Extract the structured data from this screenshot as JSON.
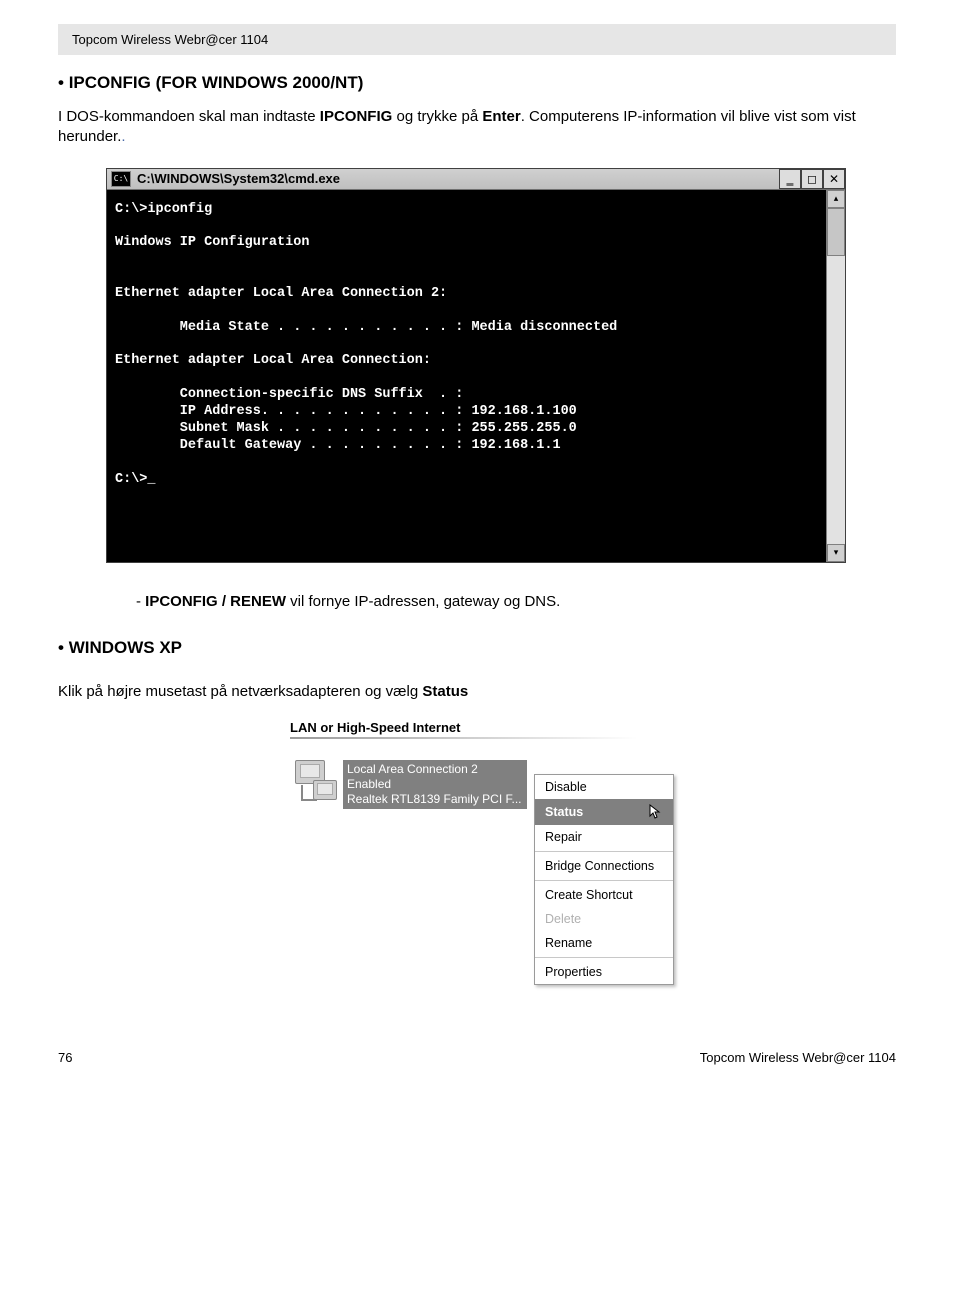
{
  "header_bar": "Topcom Wireless Webr@cer 1104",
  "section1": {
    "bullet": "•",
    "title": "IPCONFIG (FOR WINDOWS 2000/NT)",
    "para_prefix": "I DOS-kommandoen skal man indtaste ",
    "para_cmd": "IPCONFIG",
    "para_mid": " og trykke på ",
    "para_enter": "Enter",
    "para_suffix": ". Computerens IP-information vil blive vist som vist herunder.",
    "trailing_dot": "."
  },
  "cmd": {
    "title": "C:\\WINDOWS\\System32\\cmd.exe",
    "icon_text": "C:\\",
    "lines": [
      "C:\\>ipconfig",
      "",
      "Windows IP Configuration",
      "",
      "",
      "Ethernet adapter Local Area Connection 2:",
      "",
      "        Media State . . . . . . . . . . . : Media disconnected",
      "",
      "Ethernet adapter Local Area Connection:",
      "",
      "        Connection-specific DNS Suffix  . :",
      "        IP Address. . . . . . . . . . . . : 192.168.1.100",
      "        Subnet Mask . . . . . . . . . . . : 255.255.255.0",
      "        Default Gateway . . . . . . . . . : 192.168.1.1",
      "",
      "C:\\>_"
    ]
  },
  "renew": {
    "dash": "- ",
    "cmd": "IPCONFIG / RENEW",
    "text": " vil fornye IP-adressen, gateway og DNS."
  },
  "section2": {
    "bullet": "•",
    "title": "WINDOWS XP",
    "para_prefix": "Klik på højre musetast på netværksadapteren og vælg ",
    "status": "Status"
  },
  "lan": {
    "header": "LAN or High-Speed Internet",
    "line1": "Local Area Connection 2",
    "line2": "Enabled",
    "line3": "Realtek RTL8139 Family PCI F..."
  },
  "ctx": {
    "disable": "Disable",
    "status": "Status",
    "repair": "Repair",
    "bridge": "Bridge Connections",
    "shortcut": "Create Shortcut",
    "delete": "Delete",
    "rename": "Rename",
    "properties": "Properties"
  },
  "footer": {
    "page": "76",
    "product": "Topcom Wireless Webr@cer 1104"
  }
}
